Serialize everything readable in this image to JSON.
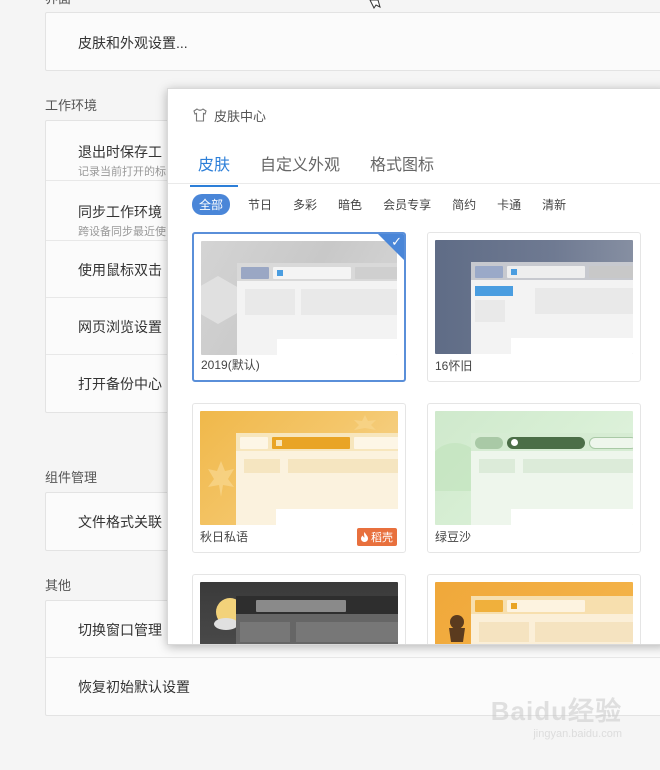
{
  "settings": {
    "top_partial_label": "界面",
    "appearance_row": "皮肤和外观设置...",
    "work_env": {
      "title": "工作环境",
      "rows": [
        {
          "title": "退出时保存工",
          "desc": "记录当前打开的标"
        },
        {
          "title": "同步工作环境",
          "desc": "跨设备同步最近使"
        },
        {
          "title": "使用鼠标双击",
          "desc": ""
        },
        {
          "title": "网页浏览设置",
          "desc": ""
        },
        {
          "title": "打开备份中心",
          "desc": ""
        }
      ]
    },
    "components": {
      "title": "组件管理",
      "rows": [
        {
          "title": "文件格式关联"
        }
      ]
    },
    "others": {
      "title": "其他",
      "rows": [
        {
          "title": "切换窗口管理"
        },
        {
          "title": "恢复初始默认设置"
        }
      ]
    }
  },
  "skin_center": {
    "title": "皮肤中心",
    "header_icon": "shirt-icon",
    "tabs": [
      {
        "label": "皮肤",
        "active": true
      },
      {
        "label": "自定义外观",
        "active": false
      },
      {
        "label": "格式图标",
        "active": false
      }
    ],
    "categories": [
      {
        "label": "全部",
        "active": true
      },
      {
        "label": "节日",
        "active": false
      },
      {
        "label": "多彩",
        "active": false
      },
      {
        "label": "暗色",
        "active": false
      },
      {
        "label": "会员专享",
        "active": false
      },
      {
        "label": "简约",
        "active": false
      },
      {
        "label": "卡通",
        "active": false
      },
      {
        "label": "清新",
        "active": false
      }
    ],
    "skins": [
      {
        "name": "2019(默认)",
        "selected": true,
        "badge": ""
      },
      {
        "name": "16怀旧",
        "selected": false,
        "badge": ""
      },
      {
        "name": "秋日私语",
        "selected": false,
        "badge": "稻壳"
      },
      {
        "name": "绿豆沙",
        "selected": false,
        "badge": ""
      },
      {
        "name": "",
        "selected": false,
        "badge": ""
      },
      {
        "name": "",
        "selected": false,
        "badge": ""
      }
    ],
    "colors": {
      "accent": "#2d7fd8",
      "selected_border": "#5a8fd9",
      "badge": "#e8703d"
    }
  },
  "watermark": {
    "text": "Baidu经验",
    "sub": "jingyan.baidu.com"
  }
}
